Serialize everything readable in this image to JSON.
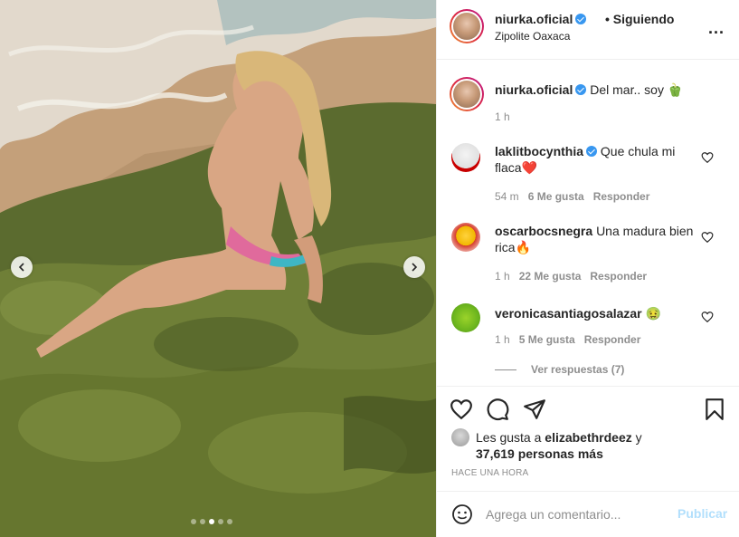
{
  "header": {
    "username": "niurka.oficial",
    "follow_status": "• Siguiendo",
    "location": "Zipolite Oaxaca"
  },
  "caption": {
    "username": "niurka.oficial",
    "text": "Del mar.. soy 🫑",
    "time": "1 h"
  },
  "comments": [
    {
      "username": "laklitbocynthia",
      "verified": true,
      "text": "Que chula mi flaca❤️",
      "time": "54 m",
      "likes": "6 Me gusta",
      "reply": "Responder"
    },
    {
      "username": "oscarbocsnegra",
      "verified": false,
      "text": "Una madura bien rica🔥",
      "time": "1 h",
      "likes": "22 Me gusta",
      "reply": "Responder"
    },
    {
      "username": "veronicasantiagosalazar",
      "verified": false,
      "text": "🤢",
      "time": "1 h",
      "likes": "5 Me gusta",
      "reply": "Responder"
    }
  ],
  "view_replies": "Ver respuestas (7)",
  "likes": {
    "prefix": "Les gusta a",
    "user": "elizabethrdeez",
    "suffix": "y",
    "others": "37,619 personas más"
  },
  "timestamp": "HACE UNA HORA",
  "comment_box": {
    "placeholder": "Agrega un comentario...",
    "publish": "Publicar"
  },
  "carousel": {
    "dot_count": 5,
    "active_index": 2
  },
  "icons": {
    "like": "heart-icon",
    "comment": "comment-icon",
    "share": "paper-plane-icon",
    "save": "bookmark-icon",
    "emoji": "smiley-icon",
    "more": "more-options-icon",
    "prev": "chevron-left-icon",
    "next": "chevron-right-icon"
  },
  "colors": {
    "verified": "#3897f0",
    "publish_disabled": "#b2dffc",
    "secondary_text": "#8e8e8e"
  }
}
